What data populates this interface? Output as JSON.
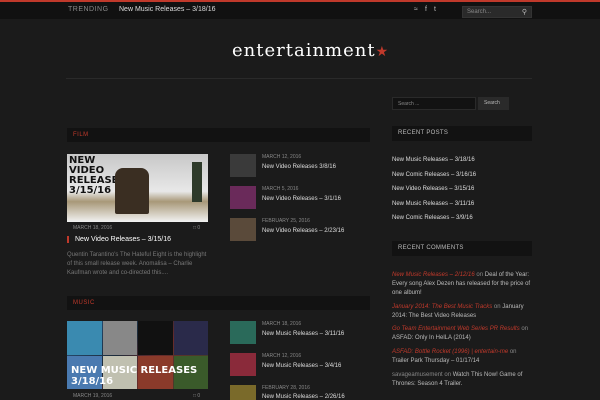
{
  "topbar": {
    "trending_label": "TRENDING",
    "trending_text": "New Music Releases – 3/18/16",
    "social": [
      "rss-icon",
      "facebook-icon",
      "twitter-icon"
    ],
    "search_placeholder": "Search..."
  },
  "logo": {
    "text": "entertainment"
  },
  "sections": {
    "film": {
      "label": "FILM",
      "featured": {
        "image_title": "NEW VIDEO RELEASES 3/15/16",
        "date": "MARCH 18, 2016",
        "comments": "0",
        "title": "New Video Releases – 3/15/16",
        "excerpt": "Quentin Tarantino's The Hateful Eight is the highlight of this small release week. Anomalisa – Charlie Kaufman wrote and co-directed this...."
      },
      "items": [
        {
          "date": "MARCH 12, 2016",
          "title": "New Video Releases 3/8/16",
          "thumb_color": "#3a3a3a"
        },
        {
          "date": "MARCH 5, 2016",
          "title": "New Video Releases – 3/1/16",
          "thumb_color": "#6a2a5a"
        },
        {
          "date": "FEBRUARY 25, 2016",
          "title": "New Video Releases – 2/23/16",
          "thumb_color": "#5a4a3a"
        }
      ]
    },
    "music": {
      "label": "MUSIC",
      "featured": {
        "image_title": "NEW MUSIC RELEASES 3/18/16",
        "date": "MARCH 19, 2016",
        "comments": "0"
      },
      "items": [
        {
          "date": "MARCH 18, 2016",
          "title": "New Music Releases – 3/11/16",
          "thumb_color": "#2a6a5a"
        },
        {
          "date": "MARCH 12, 2016",
          "title": "New Music Releases – 3/4/16",
          "thumb_color": "#8a2a3a"
        },
        {
          "date": "FEBRUARY 28, 2016",
          "title": "New Music Releases – 2/26/16",
          "thumb_color": "#7a6a2a"
        }
      ]
    }
  },
  "sidebar": {
    "search_placeholder": "Search ...",
    "search_button": "Search",
    "recent_posts_title": "RECENT POSTS",
    "recent_posts": [
      "New Music Releases – 3/18/16",
      "New Comic Releases – 3/16/16",
      "New Video Releases – 3/15/16",
      "New Music Releases – 3/11/16",
      "New Comic Releases – 3/9/16"
    ],
    "recent_comments_title": "RECENT COMMENTS",
    "recent_comments": [
      {
        "author": "New Music Releases – 2/12/16",
        "on": " on ",
        "post": "Deal of the Year: Every song Alex Dezen has released for the price of one album!"
      },
      {
        "author": "January 2014: The Best Music Tracks",
        "on": " on ",
        "post": "January 2014: The Best Video Releases"
      },
      {
        "author": "Go Team Entertainment Web Series PR Results",
        "on": " on ",
        "post": "ASFAD: Only In HelLA (2014)"
      },
      {
        "author": "ASFAD: Bottle Rocket (1996) | entertain-me",
        "on": " on ",
        "post": "Trailer Park Thursday – 01/17/14"
      },
      {
        "author": "savageamusement",
        "on": " on ",
        "post": "Watch This Now! Game of Thrones: Season 4 Trailer."
      }
    ]
  },
  "colors": {
    "accent": "#c0392b",
    "background": "#1b1b1b"
  }
}
